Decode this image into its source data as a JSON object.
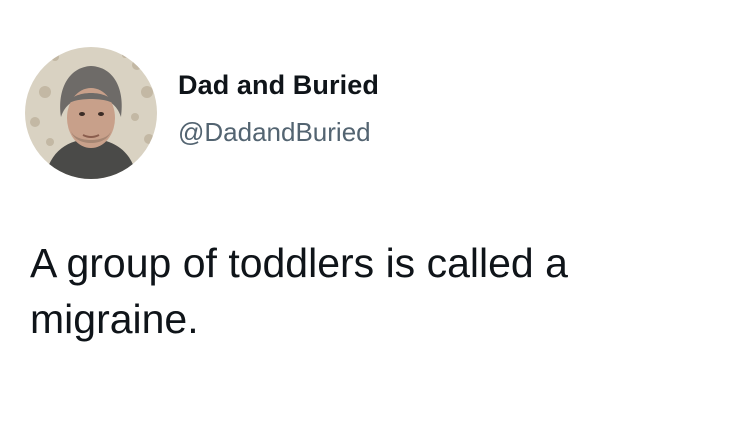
{
  "tweet": {
    "author": {
      "display_name": "Dad and Buried",
      "handle": "@DadandBuried",
      "avatar_icon": "profile-photo"
    },
    "text": "A group of toddlers is called a migraine."
  },
  "colors": {
    "background": "#ffffff",
    "text": "#0f1419",
    "handle": "#536471"
  }
}
